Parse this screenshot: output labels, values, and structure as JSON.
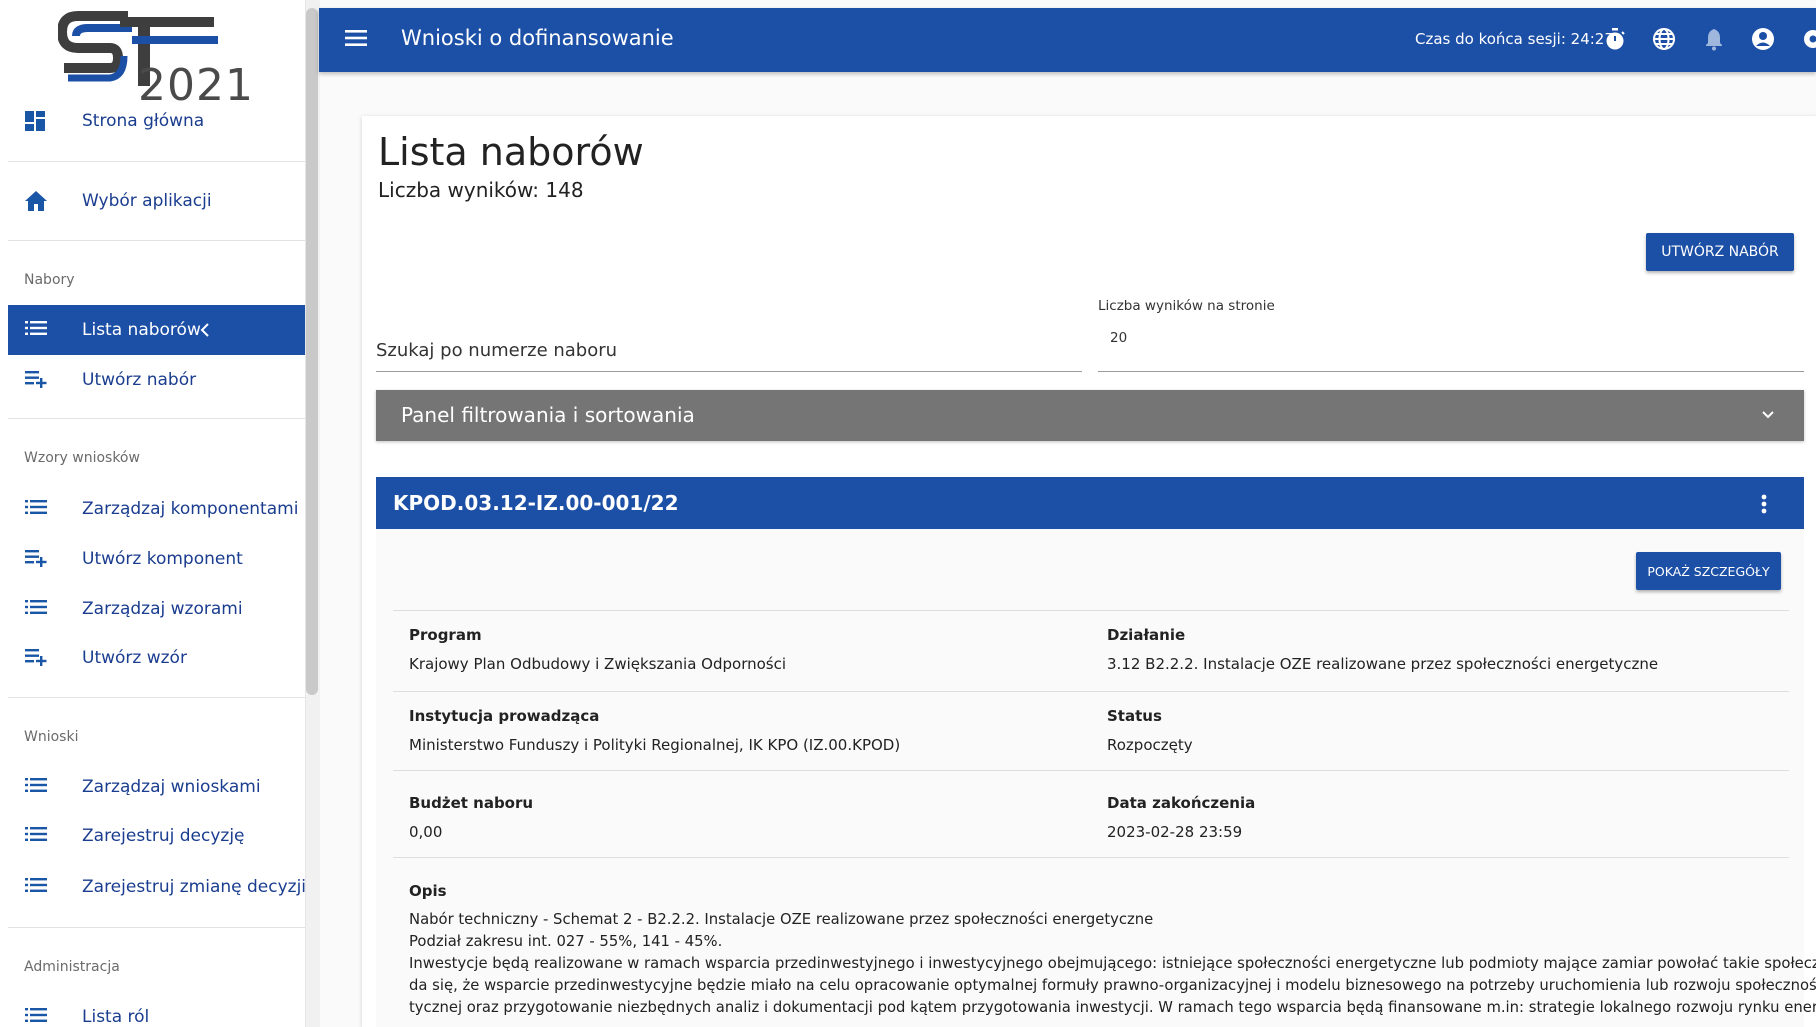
{
  "logo": {
    "text": "2021"
  },
  "sidebar": {
    "items": [
      {
        "label": "Strona główna",
        "icon": "dashboard-icon"
      },
      {
        "label": "Wybór aplikacji",
        "icon": "home-icon"
      },
      {
        "label": "Lista naborów",
        "icon": "list-icon"
      },
      {
        "label": "Utwórz nabór",
        "icon": "playlist-add-icon"
      },
      {
        "label": "Zarządzaj komponentami",
        "icon": "list-icon"
      },
      {
        "label": "Utwórz komponent",
        "icon": "playlist-add-icon"
      },
      {
        "label": "Zarządzaj wzorami",
        "icon": "list-icon"
      },
      {
        "label": "Utwórz wzór",
        "icon": "playlist-add-icon"
      },
      {
        "label": "Zarządzaj wnioskami",
        "icon": "list-icon"
      },
      {
        "label": "Zarejestruj decyzję",
        "icon": "list-icon"
      },
      {
        "label": "Zarejestruj zmianę decyzji",
        "icon": "list-icon"
      },
      {
        "label": "Lista ról",
        "icon": "list-icon"
      }
    ],
    "sections": {
      "nabory": "Nabory",
      "wzory": "Wzory wniosków",
      "wnioski": "Wnioski",
      "admin": "Administracja"
    }
  },
  "header": {
    "title": "Wnioski o dofinansowanie",
    "session_label": "Czas do końca sesji: 24:27"
  },
  "main": {
    "title": "Lista naborów",
    "result_count": "Liczba wyników: 148",
    "create_button": "UTWÓRZ NABÓR",
    "search_placeholder": "Szukaj po numerze naboru",
    "per_page_label": "Liczba wyników na stronie",
    "per_page_value": "20",
    "filter_panel_label": "Panel filtrowania i sortowania"
  },
  "nabor": {
    "number": "KPOD.03.12-IZ.00-001/22",
    "details_button": "POKAŻ SZCZEGÓŁY",
    "program_label": "Program",
    "program_value": "Krajowy Plan Odbudowy i Zwiększania Odporności",
    "dzialanie_label": "Działanie",
    "dzialanie_value": "3.12 B2.2.2. Instalacje OZE realizowane przez społeczności energetyczne",
    "instytucja_label": "Instytucja prowadząca",
    "instytucja_value": "Ministerstwo Funduszy i Polityki Regionalnej, IK KPO (IZ.00.KPOD)",
    "status_label": "Status",
    "status_value": "Rozpoczęty",
    "budzet_label": "Budżet naboru",
    "budzet_value": "0,00",
    "data_label": "Data zakończenia",
    "data_value": "2023-02-28 23:59",
    "opis_label": "Opis",
    "opis_lines": [
      "Nabór techniczny - Schemat 2 - B2.2.2. Instalacje OZE realizowane przez społeczności energetyczne",
      "Podział zakresu int. 027 - 55%, 141 - 45%.",
      "Inwestycje będą realizowane w ramach wsparcia przedinwestyjnego i inwestycyjnego obejmującego: istniejące społeczności energetyczne lub podmioty mające zamiar powołać takie społeczności. Zakła-",
      "da się, że wsparcie przedinwestycyjne będzie miało na celu opracowanie optymalnej formuły prawno-organizacyjnej i modelu biznesowego na potrzeby uruchomienia lub rozwoju społeczności energe-",
      "tycznej oraz przygotowanie niezbędnych analiz i dokumentacji pod kątem przygotowania inwestycji. W ramach tego wsparcia będą finansowane m.in: strategie lokalnego rozwoju rynku energii, analizy"
    ]
  },
  "colors": {
    "primary": "#1c4fa6",
    "filter_panel": "#757575"
  }
}
